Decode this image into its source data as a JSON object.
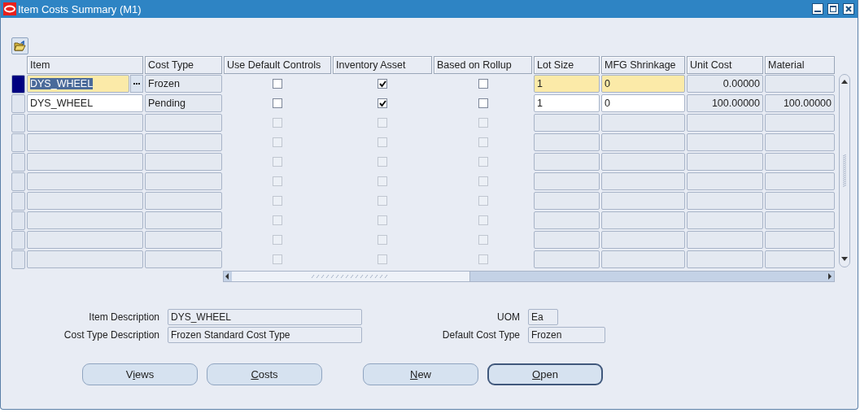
{
  "window": {
    "title": "Item Costs Summary (M1)"
  },
  "table": {
    "columns": [
      "Item",
      "Cost Type",
      "Use Default Controls",
      "Inventory Asset",
      "Based on Rollup",
      "Lot Size",
      "MFG Shrinkage",
      "Unit Cost",
      "Material"
    ],
    "rows": [
      {
        "selected": true,
        "enabled": true,
        "item": "DYS_WHEEL",
        "cost_type": "Frozen",
        "use_default_controls": false,
        "inventory_asset": true,
        "based_on_rollup": false,
        "lot_size": "1",
        "mfg_shrinkage": "0",
        "unit_cost": "0.00000"
      },
      {
        "selected": false,
        "enabled": true,
        "item": "DYS_WHEEL",
        "cost_type": "Pending",
        "use_default_controls": false,
        "inventory_asset": true,
        "based_on_rollup": false,
        "lot_size": "1",
        "mfg_shrinkage": "0",
        "unit_cost": "100.00000",
        "material": "100.00000"
      },
      {
        "selected": false,
        "enabled": false,
        "use_default_controls": false,
        "inventory_asset": false,
        "based_on_rollup": false
      },
      {
        "selected": false,
        "enabled": false,
        "use_default_controls": false,
        "inventory_asset": false,
        "based_on_rollup": false
      },
      {
        "selected": false,
        "enabled": false,
        "use_default_controls": false,
        "inventory_asset": false,
        "based_on_rollup": false
      },
      {
        "selected": false,
        "enabled": false,
        "use_default_controls": false,
        "inventory_asset": false,
        "based_on_rollup": false
      },
      {
        "selected": false,
        "enabled": false,
        "use_default_controls": false,
        "inventory_asset": false,
        "based_on_rollup": false
      },
      {
        "selected": false,
        "enabled": false,
        "use_default_controls": false,
        "inventory_asset": false,
        "based_on_rollup": false
      },
      {
        "selected": false,
        "enabled": false,
        "use_default_controls": false,
        "inventory_asset": false,
        "based_on_rollup": false
      },
      {
        "selected": false,
        "enabled": false,
        "use_default_controls": false,
        "inventory_asset": false,
        "based_on_rollup": false
      }
    ]
  },
  "details": {
    "item_description": {
      "label": "Item Description",
      "value": "DYS_WHEEL"
    },
    "cost_type_description": {
      "label": "Cost Type Description",
      "value": "Frozen Standard Cost Type"
    },
    "uom": {
      "label": "UOM",
      "value": "Ea"
    },
    "default_cost_type": {
      "label": "Default Cost Type",
      "value": "Frozen"
    }
  },
  "buttons": [
    {
      "before": "V",
      "mnemonic": "i",
      "after": "ews",
      "default": false
    },
    {
      "mnemonic": "C",
      "after": "osts",
      "default": false
    },
    {
      "mnemonic": "N",
      "after": "ew",
      "default": false
    },
    {
      "mnemonic": "O",
      "after": "pen",
      "default": true
    }
  ]
}
